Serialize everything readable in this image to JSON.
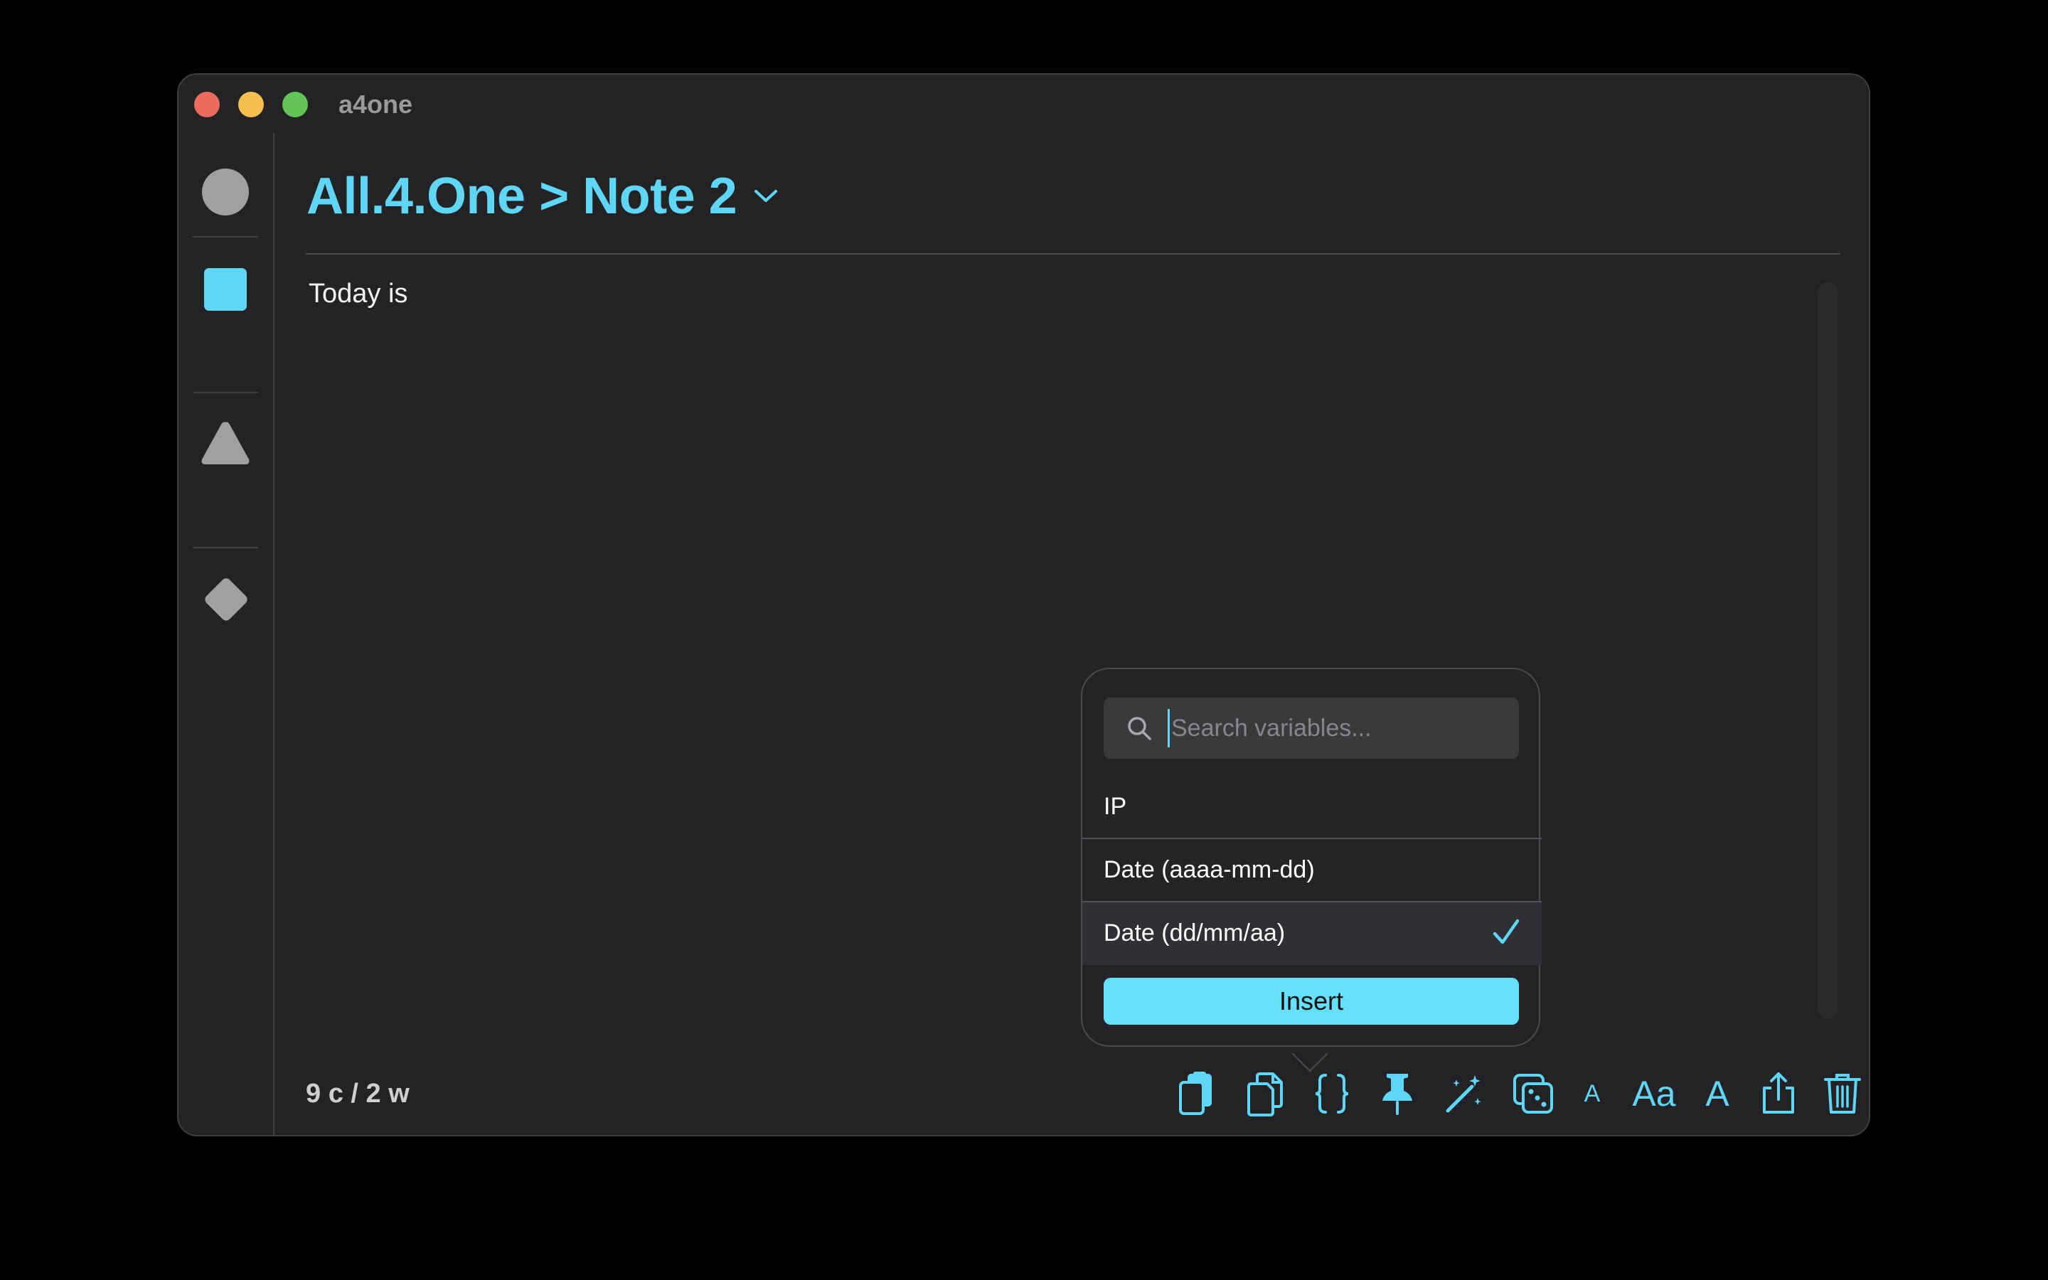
{
  "window": {
    "title": "a4one"
  },
  "sidebar": {
    "items": [
      {
        "name": "circle"
      },
      {
        "name": "square",
        "active": true
      },
      {
        "name": "triangle"
      },
      {
        "name": "diamond"
      }
    ]
  },
  "header": {
    "breadcrumb": "All.4.One > Note 2"
  },
  "editor": {
    "content": "Today is"
  },
  "status": {
    "count": "9 c / 2 w"
  },
  "popover": {
    "search_placeholder": "Search variables...",
    "items": [
      {
        "label": "IP"
      },
      {
        "label": "Date (aaaa-mm-dd)"
      },
      {
        "label": "Date (dd/mm/aa)",
        "selected": true
      }
    ],
    "insert_label": "Insert"
  },
  "toolbar": {
    "font_small": "A",
    "font_case": "Aa",
    "font_large": "A"
  },
  "colors": {
    "accent": "#5fd6f5",
    "button": "#66dff9",
    "background": "#232224",
    "sidebar_inactive": "#a0a0a3"
  }
}
